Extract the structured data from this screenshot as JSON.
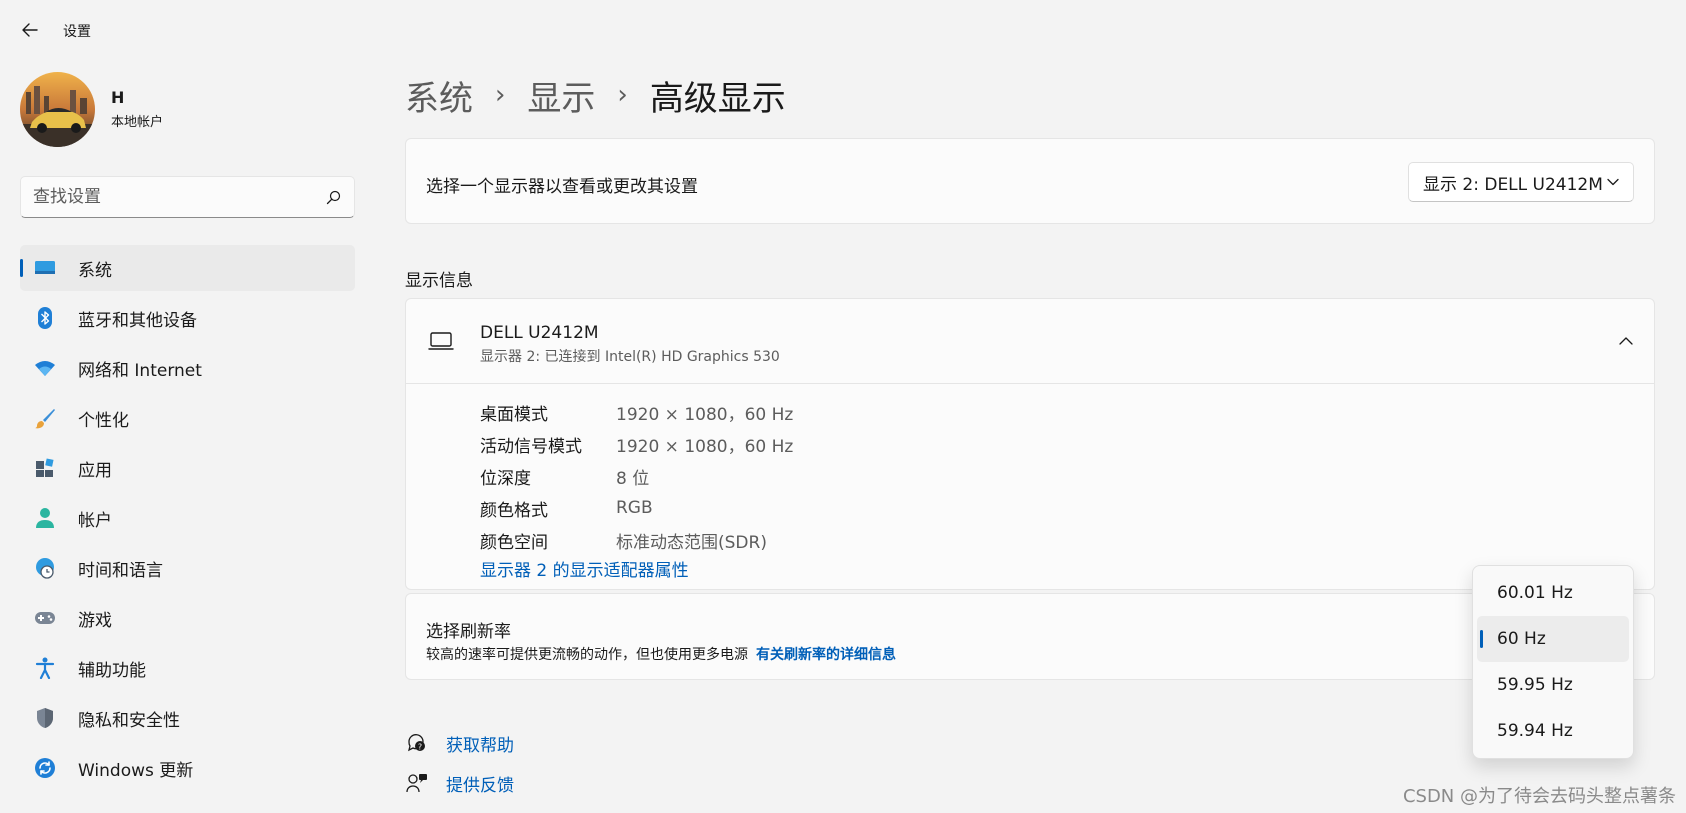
{
  "window": {
    "title": "设置"
  },
  "user": {
    "name": "H",
    "account_type": "本地帐户"
  },
  "search": {
    "placeholder": "查找设置"
  },
  "sidebar": {
    "items": [
      {
        "label": "系统",
        "icon": "monitor-icon",
        "active": true
      },
      {
        "label": "蓝牙和其他设备",
        "icon": "bluetooth-icon"
      },
      {
        "label": "网络和 Internet",
        "icon": "wifi-icon"
      },
      {
        "label": "个性化",
        "icon": "brush-icon"
      },
      {
        "label": "应用",
        "icon": "apps-icon"
      },
      {
        "label": "帐户",
        "icon": "person-icon"
      },
      {
        "label": "时间和语言",
        "icon": "globe-clock-icon"
      },
      {
        "label": "游戏",
        "icon": "gamepad-icon"
      },
      {
        "label": "辅助功能",
        "icon": "accessibility-icon"
      },
      {
        "label": "隐私和安全性",
        "icon": "shield-icon"
      },
      {
        "label": "Windows 更新",
        "icon": "update-icon"
      }
    ]
  },
  "breadcrumb": {
    "level1": "系统",
    "level2": "显示",
    "current": "高级显示"
  },
  "select_display": {
    "label": "选择一个显示器以查看或更改其设置",
    "selected": "显示 2: DELL U2412M"
  },
  "display_info": {
    "section_title": "显示信息",
    "monitor_name": "DELL U2412M",
    "monitor_subtitle": "显示器 2: 已连接到 Intel(R) HD Graphics 530",
    "rows": [
      {
        "key": "桌面模式",
        "value": "1920 × 1080，60 Hz"
      },
      {
        "key": "活动信号模式",
        "value": "1920 × 1080，60 Hz"
      },
      {
        "key": "位深度",
        "value": "8 位"
      },
      {
        "key": "颜色格式",
        "value": "RGB"
      },
      {
        "key": "颜色空间",
        "value": "标准动态范围(SDR)"
      }
    ],
    "adapter_link": "显示器 2 的显示适配器属性"
  },
  "refresh_rate": {
    "title": "选择刷新率",
    "subtitle": "较高的速率可提供更流畅的动作，但也使用更多电源",
    "link": "有关刷新率的详细信息",
    "options": [
      "60.01 Hz",
      "60 Hz",
      "59.95 Hz",
      "59.94 Hz"
    ],
    "selected_index": 1
  },
  "help": {
    "get_help": "获取帮助",
    "feedback": "提供反馈"
  },
  "colors": {
    "accent": "#005fb8",
    "background": "#f3f3f3",
    "card": "#fbfbfb"
  },
  "watermark": "CSDN @为了待会去码头整点薯条"
}
